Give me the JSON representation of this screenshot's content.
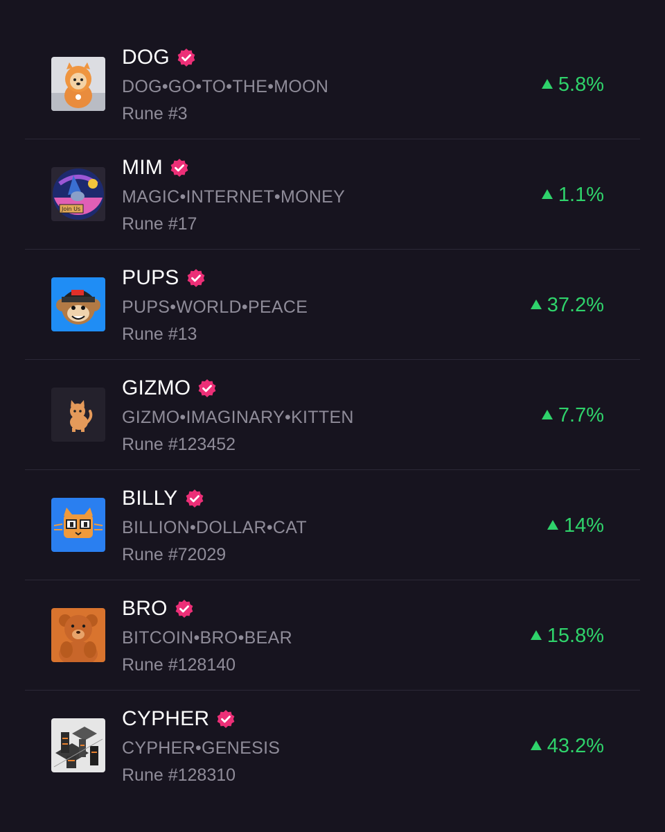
{
  "colors": {
    "background": "#17141f",
    "positive": "#2fd36b",
    "verified": "#ec2f77",
    "muted_text": "#8f8c99"
  },
  "runes": [
    {
      "ticker": "DOG",
      "full_name": "DOG•GO•TO•THE•MOON",
      "rune_id": "Rune #3",
      "change": "5.8%",
      "icon": "dog-hoodie-avatar-icon"
    },
    {
      "ticker": "MIM",
      "full_name": "MAGIC•INTERNET•MONEY",
      "rune_id": "Rune #17",
      "change": "1.1%",
      "icon": "wizard-join-us-avatar-icon"
    },
    {
      "ticker": "PUPS",
      "full_name": "PUPS•WORLD•PEACE",
      "rune_id": "Rune #13",
      "change": "37.2%",
      "icon": "pups-monkey-beanie-avatar-icon"
    },
    {
      "ticker": "GIZMO",
      "full_name": "GIZMO•IMAGINARY•KITTEN",
      "rune_id": "Rune #123452",
      "change": "7.7%",
      "icon": "orange-kitten-avatar-icon"
    },
    {
      "ticker": "BILLY",
      "full_name": "BILLION•DOLLAR•CAT",
      "rune_id": "Rune #72029",
      "change": "14%",
      "icon": "cat-face-avatar-icon"
    },
    {
      "ticker": "BRO",
      "full_name": "BITCOIN•BRO•BEAR",
      "rune_id": "Rune #128140",
      "change": "15.8%",
      "icon": "plush-bear-avatar-icon"
    },
    {
      "ticker": "CYPHER",
      "full_name": "CYPHER•GENESIS",
      "rune_id": "Rune #128310",
      "change": "43.2%",
      "icon": "isometric-city-avatar-icon"
    }
  ]
}
